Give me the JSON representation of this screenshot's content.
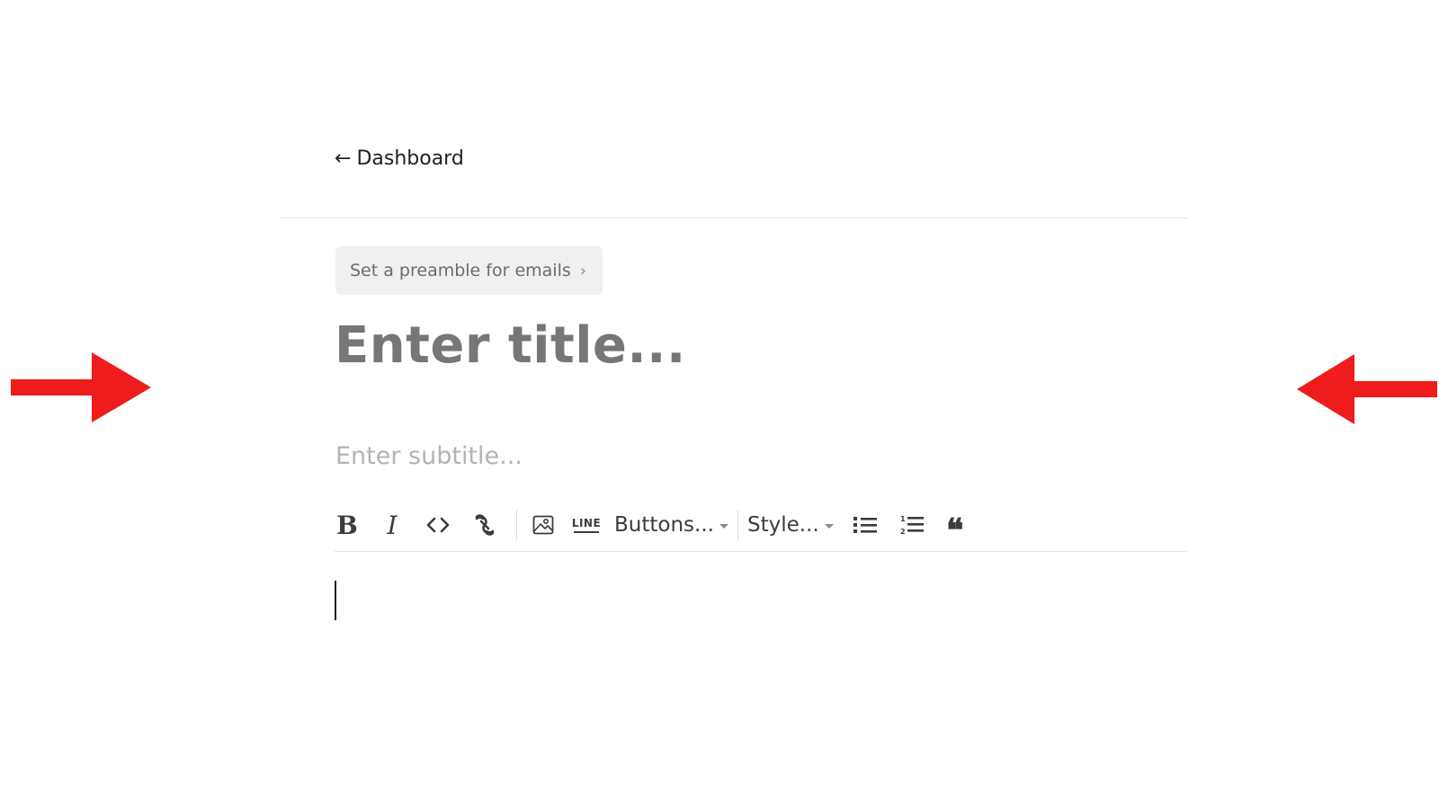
{
  "nav": {
    "back_arrow": "←",
    "back_label": "Dashboard"
  },
  "preamble": {
    "label": "Set a preamble for emails",
    "chevron": "›"
  },
  "editor": {
    "title_placeholder": "Enter title...",
    "subtitle_placeholder": "Enter subtitle...",
    "body_text": ""
  },
  "toolbar": {
    "bold": "B",
    "italic": "I",
    "code_icon": "code-icon",
    "link_icon": "link-icon",
    "image_icon": "image-icon",
    "line_label": "LINE",
    "buttons_label": "Buttons...",
    "style_label": "Style...",
    "bullet_list_icon": "bullet-list-icon",
    "numbered_list_icon": "numbered-list-icon",
    "quote_label": "❝"
  },
  "annotations": {
    "arrow_color": "#ee1c1c",
    "left_arrow_icon": "right-pointing-arrow-icon",
    "right_arrow_icon": "left-pointing-arrow-icon"
  },
  "colors": {
    "divider": "#f3dede",
    "title_text": "#767676",
    "subtitle_text": "#b3b3b3",
    "preamble_bg": "#f0f0f0"
  }
}
